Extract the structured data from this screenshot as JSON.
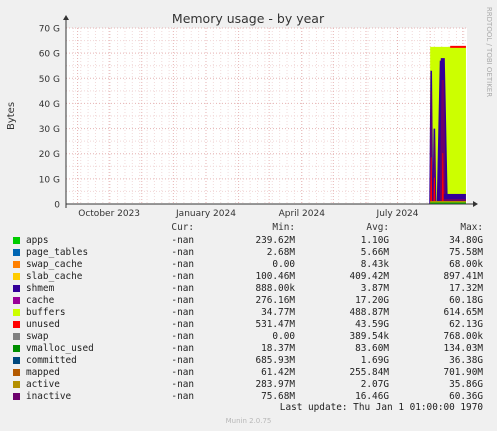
{
  "chart_data": {
    "type": "area",
    "title": "Memory usage - by year",
    "ylabel": "Bytes",
    "side_label": "RRDTOOL / TOBI OETIKER",
    "y_ticks": [
      "0",
      "10 G",
      "20 G",
      "30 G",
      "40 G",
      "50 G",
      "60 G",
      "70 G"
    ],
    "ylim": [
      0,
      70
    ],
    "y_unit": "G",
    "x_ticks": [
      "October 2023",
      "January 2024",
      "April 2024",
      "July 2024"
    ],
    "x_range": [
      "2023-08-21",
      "2024-09-05"
    ],
    "x_tick_dates": [
      "2023-10-01",
      "2024-01-01",
      "2024-04-01",
      "2024-07-01"
    ],
    "grid": true,
    "series": [
      {
        "name": "apps",
        "color": "#00cc00",
        "cur": "-nan",
        "min": "239.62M",
        "avg": "1.10G",
        "max": "34.80G"
      },
      {
        "name": "page_tables",
        "color": "#0066b3",
        "cur": "-nan",
        "min": "2.68M",
        "avg": "5.66M",
        "max": "75.58M"
      },
      {
        "name": "swap_cache",
        "color": "#ff8000",
        "cur": "-nan",
        "min": "0.00",
        "avg": "8.43k",
        "max": "68.00k"
      },
      {
        "name": "slab_cache",
        "color": "#ffcc00",
        "cur": "-nan",
        "min": "100.46M",
        "avg": "409.42M",
        "max": "897.41M"
      },
      {
        "name": "shmem",
        "color": "#330099",
        "cur": "-nan",
        "min": "888.00k",
        "avg": "3.87M",
        "max": "17.32M"
      },
      {
        "name": "cache",
        "color": "#990099",
        "cur": "-nan",
        "min": "276.16M",
        "avg": "17.20G",
        "max": "60.18G"
      },
      {
        "name": "buffers",
        "color": "#ccff00",
        "cur": "-nan",
        "min": "34.77M",
        "avg": "488.87M",
        "max": "614.65M"
      },
      {
        "name": "unused",
        "color": "#ff0000",
        "cur": "-nan",
        "min": "531.47M",
        "avg": "43.59G",
        "max": "62.13G"
      },
      {
        "name": "swap",
        "color": "#808080",
        "cur": "-nan",
        "min": "0.00",
        "avg": "389.54k",
        "max": "768.00k"
      },
      {
        "name": "vmalloc_used",
        "color": "#008f00",
        "cur": "-nan",
        "min": "18.37M",
        "avg": "83.60M",
        "max": "134.03M"
      },
      {
        "name": "committed",
        "color": "#00487d",
        "cur": "-nan",
        "min": "685.93M",
        "avg": "1.69G",
        "max": "36.38G"
      },
      {
        "name": "mapped",
        "color": "#b35a00",
        "cur": "-nan",
        "min": "61.42M",
        "avg": "255.84M",
        "max": "701.90M"
      },
      {
        "name": "active",
        "color": "#b38f00",
        "cur": "-nan",
        "min": "283.97M",
        "avg": "2.07G",
        "max": "35.86G"
      },
      {
        "name": "inactive",
        "color": "#6b006b",
        "cur": "-nan",
        "min": "75.68M",
        "avg": "16.46G",
        "max": "60.36G"
      }
    ],
    "activity": {
      "start": "2024-08-01",
      "end": "2024-09-04",
      "total_level": 62.5,
      "cache_spikes": [
        {
          "date": "2024-08-02",
          "value": 53
        },
        {
          "date": "2024-08-05",
          "value": 30
        },
        {
          "date": "2024-08-12",
          "value": 57
        },
        {
          "date": "2024-08-13",
          "value": 58
        }
      ],
      "tail_level": 4.0
    }
  },
  "legend_header": {
    "cur": "Cur:",
    "min": "Min:",
    "avg": "Avg:",
    "max": "Max:"
  },
  "last_update": "Last update: Thu Jan  1 01:00:00 1970",
  "footer": "Munin 2.0.75"
}
